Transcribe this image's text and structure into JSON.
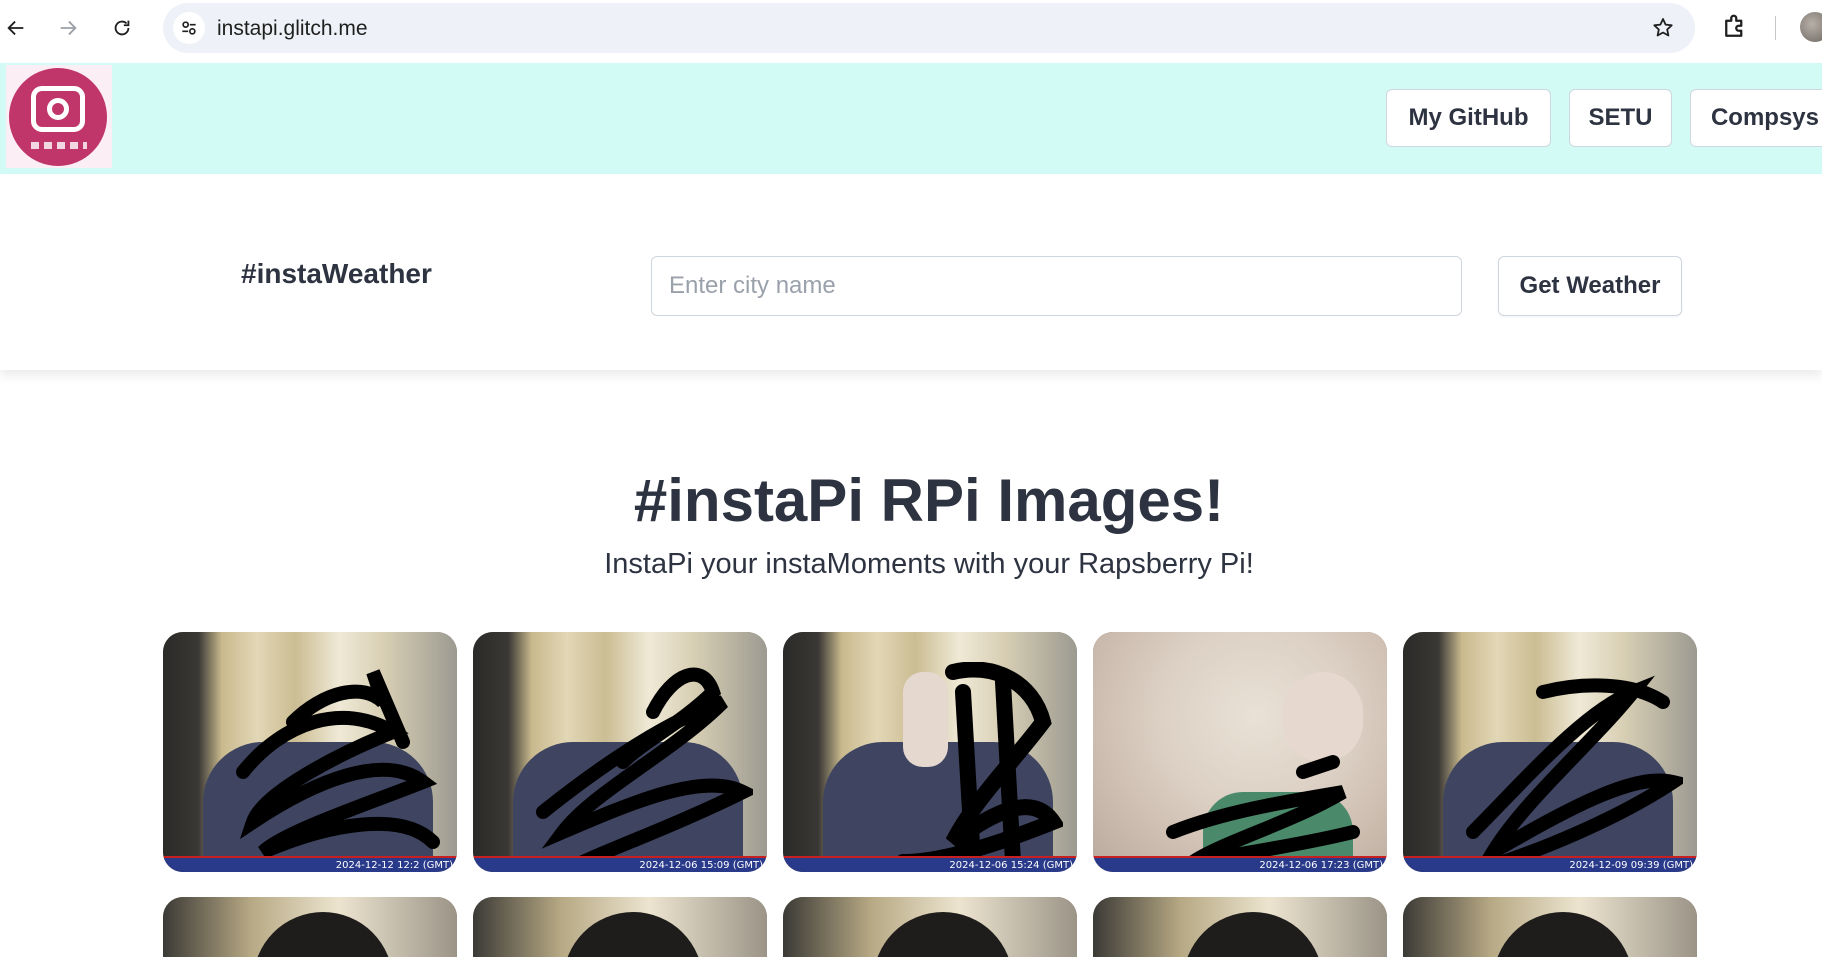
{
  "browser": {
    "url": "instapi.glitch.me",
    "back_icon": "arrow-left-icon",
    "forward_icon": "arrow-right-icon",
    "reload_icon": "reload-icon",
    "site_info_icon": "tune-icon",
    "bookmark_icon": "star-icon",
    "extensions_icon": "puzzle-icon",
    "profile_icon": "avatar"
  },
  "header": {
    "nav": [
      "My GitHub",
      "SETU",
      "Compsys"
    ],
    "background": "#d2fbf6",
    "logo_color": "#c0366a"
  },
  "weather": {
    "title": "#instaWeather",
    "placeholder": "Enter city name",
    "value": "",
    "button_label": "Get Weather"
  },
  "main": {
    "title": "#instaPi RPi Images!",
    "subtitle": "InstaPi your instaMoments with your Rapsberry Pi!"
  },
  "gallery": {
    "row1": [
      {
        "timestamp": "2024-12-12 12:2 (GMT)"
      },
      {
        "timestamp": "2024-12-06 15:09 (GMT)"
      },
      {
        "timestamp": "2024-12-06 15:24 (GMT)"
      },
      {
        "timestamp": "2024-12-06 17:23 (GMT)"
      },
      {
        "timestamp": "2024-12-09 09:39 (GMT)"
      }
    ],
    "row2_count": 5
  }
}
